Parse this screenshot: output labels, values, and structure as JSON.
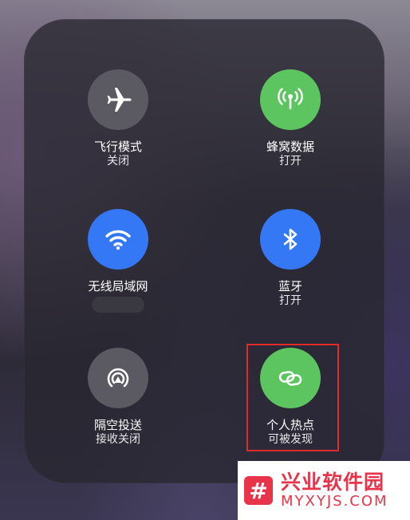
{
  "tiles": {
    "airplane": {
      "title": "飞行模式",
      "status": "关闭",
      "color": "#5b5961"
    },
    "cellular": {
      "title": "蜂窝数据",
      "status": "打开",
      "color": "#5cc55f"
    },
    "wifi": {
      "title": "无线局域网",
      "status": "",
      "color": "#3478f6"
    },
    "bluetooth": {
      "title": "蓝牙",
      "status": "打开",
      "color": "#3478f6"
    },
    "airdrop": {
      "title": "隔空投送",
      "status": "接收关闭",
      "color": "#5b5961"
    },
    "hotspot": {
      "title": "个人热点",
      "status": "可被发现",
      "color": "#5cc55f"
    }
  },
  "watermark": {
    "logo": "#",
    "name": "兴业软件园",
    "url": "MYXYJS.COM"
  }
}
